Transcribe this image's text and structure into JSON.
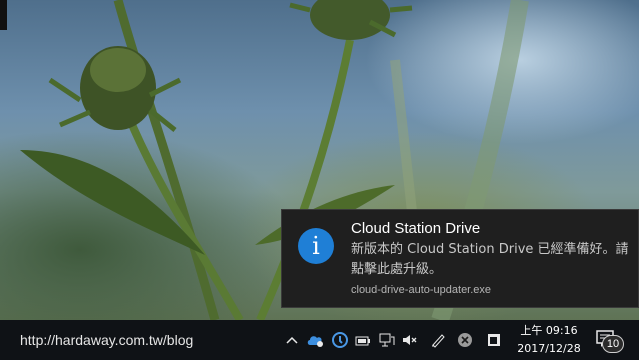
{
  "notification": {
    "title": "Cloud Station Drive",
    "message": "新版本的 Cloud Station Drive 已經準備好。請點擊此處升級。",
    "source": "cloud-drive-auto-updater.exe",
    "icon": "info-icon",
    "icon_glyph": "i",
    "accent_color": "#1f7fd6"
  },
  "watermark": {
    "text": "http://hardaway.com.tw/blog"
  },
  "taskbar": {
    "tray_icons": [
      "chevron-up-icon",
      "cloud-sync-icon",
      "cloud-station-icon",
      "battery-icon",
      "network-icon",
      "volume-muted-icon",
      "pen-icon",
      "close-circle-icon",
      "window-icon"
    ],
    "time": "上午 09:16",
    "date": "2017/12/28",
    "notification_count": "10"
  }
}
